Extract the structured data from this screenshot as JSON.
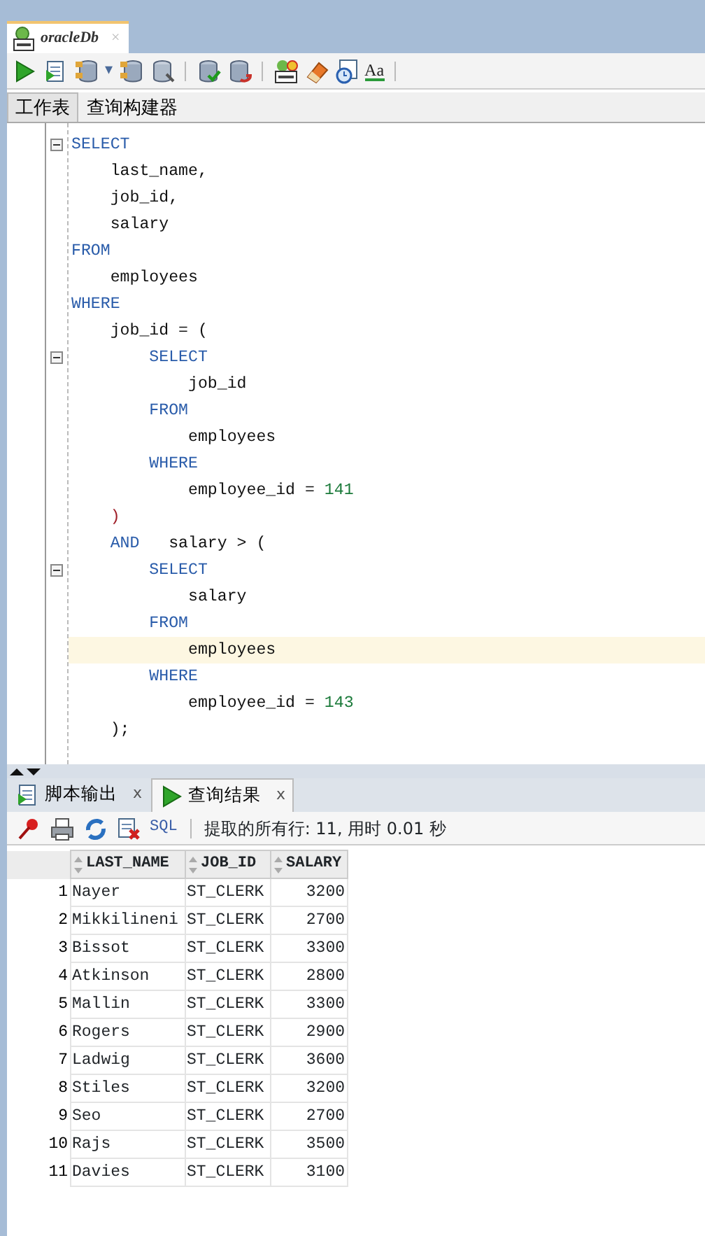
{
  "document_tab": {
    "title": "oracleDb",
    "close": "×",
    "selected": true
  },
  "toolbar": {
    "caret": "▾",
    "text_icon": "Aa"
  },
  "editor_tabs": [
    {
      "label": "工作表",
      "selected": true
    },
    {
      "label": "查询构建器",
      "selected": false
    }
  ],
  "code": [
    {
      "fold": true,
      "current": false,
      "tokens": [
        {
          "kind": "keyword",
          "text": "SELECT"
        }
      ]
    },
    {
      "fold": false,
      "current": false,
      "tokens": [
        {
          "kind": "plain",
          "text": "    last_name,"
        }
      ]
    },
    {
      "fold": false,
      "current": false,
      "tokens": [
        {
          "kind": "plain",
          "text": "    job_id,"
        }
      ]
    },
    {
      "fold": false,
      "current": false,
      "tokens": [
        {
          "kind": "plain",
          "text": "    salary"
        }
      ]
    },
    {
      "fold": false,
      "current": false,
      "tokens": [
        {
          "kind": "keyword",
          "text": "FROM"
        }
      ]
    },
    {
      "fold": false,
      "current": false,
      "tokens": [
        {
          "kind": "plain",
          "text": "    employees"
        }
      ]
    },
    {
      "fold": false,
      "current": false,
      "tokens": [
        {
          "kind": "keyword",
          "text": "WHERE"
        }
      ]
    },
    {
      "fold": false,
      "current": false,
      "tokens": [
        {
          "kind": "plain",
          "text": "    job_id = ("
        }
      ]
    },
    {
      "fold": true,
      "current": false,
      "tokens": [
        {
          "kind": "keyword",
          "text": "        SELECT"
        }
      ]
    },
    {
      "fold": false,
      "current": false,
      "tokens": [
        {
          "kind": "plain",
          "text": "            job_id"
        }
      ]
    },
    {
      "fold": false,
      "current": false,
      "tokens": [
        {
          "kind": "keyword",
          "text": "        FROM"
        }
      ]
    },
    {
      "fold": false,
      "current": false,
      "tokens": [
        {
          "kind": "plain",
          "text": "            employees"
        }
      ]
    },
    {
      "fold": false,
      "current": false,
      "tokens": [
        {
          "kind": "keyword",
          "text": "        WHERE"
        }
      ]
    },
    {
      "fold": false,
      "current": false,
      "tokens": [
        {
          "kind": "plain",
          "text": "            employee_id = "
        },
        {
          "kind": "number",
          "text": "141"
        }
      ]
    },
    {
      "fold": false,
      "current": false,
      "tokens": [
        {
          "kind": "paren",
          "text": "    )"
        }
      ]
    },
    {
      "fold": false,
      "current": false,
      "tokens": [
        {
          "kind": "keyword",
          "text": "    AND"
        },
        {
          "kind": "plain",
          "text": "   salary > ("
        }
      ]
    },
    {
      "fold": true,
      "current": false,
      "tokens": [
        {
          "kind": "keyword",
          "text": "        SELECT"
        }
      ]
    },
    {
      "fold": false,
      "current": false,
      "tokens": [
        {
          "kind": "plain",
          "text": "            salary"
        }
      ]
    },
    {
      "fold": false,
      "current": false,
      "tokens": [
        {
          "kind": "keyword",
          "text": "        FROM"
        }
      ]
    },
    {
      "fold": false,
      "current": true,
      "tokens": [
        {
          "kind": "plain",
          "text": "            employees"
        }
      ]
    },
    {
      "fold": false,
      "current": false,
      "tokens": [
        {
          "kind": "keyword",
          "text": "        WHERE"
        }
      ]
    },
    {
      "fold": false,
      "current": false,
      "tokens": [
        {
          "kind": "plain",
          "text": "            employee_id = "
        },
        {
          "kind": "number",
          "text": "143"
        }
      ]
    },
    {
      "fold": false,
      "current": false,
      "tokens": [
        {
          "kind": "plain",
          "text": "    );"
        }
      ]
    }
  ],
  "output_tabs": [
    {
      "label": "脚本输出",
      "close": "x",
      "selected": false,
      "kind": "script"
    },
    {
      "label": "查询结果",
      "close": "x",
      "selected": true,
      "kind": "run"
    }
  ],
  "results_toolbar": {
    "sql_link": "SQL",
    "status": "提取的所有行: 11, 用时 0.01 秒"
  },
  "table": {
    "columns": [
      "",
      "LAST_NAME",
      "JOB_ID",
      "SALARY"
    ],
    "rows": [
      [
        "1",
        "Nayer",
        "ST_CLERK",
        "3200"
      ],
      [
        "2",
        "Mikkilineni",
        "ST_CLERK",
        "2700"
      ],
      [
        "3",
        "Bissot",
        "ST_CLERK",
        "3300"
      ],
      [
        "4",
        "Atkinson",
        "ST_CLERK",
        "2800"
      ],
      [
        "5",
        "Mallin",
        "ST_CLERK",
        "3300"
      ],
      [
        "6",
        "Rogers",
        "ST_CLERK",
        "2900"
      ],
      [
        "7",
        "Ladwig",
        "ST_CLERK",
        "3600"
      ],
      [
        "8",
        "Stiles",
        "ST_CLERK",
        "3200"
      ],
      [
        "9",
        "Seo",
        "ST_CLERK",
        "2700"
      ],
      [
        "10",
        "Rajs",
        "ST_CLERK",
        "3500"
      ],
      [
        "11",
        "Davies",
        "ST_CLERK",
        "3100"
      ]
    ]
  }
}
